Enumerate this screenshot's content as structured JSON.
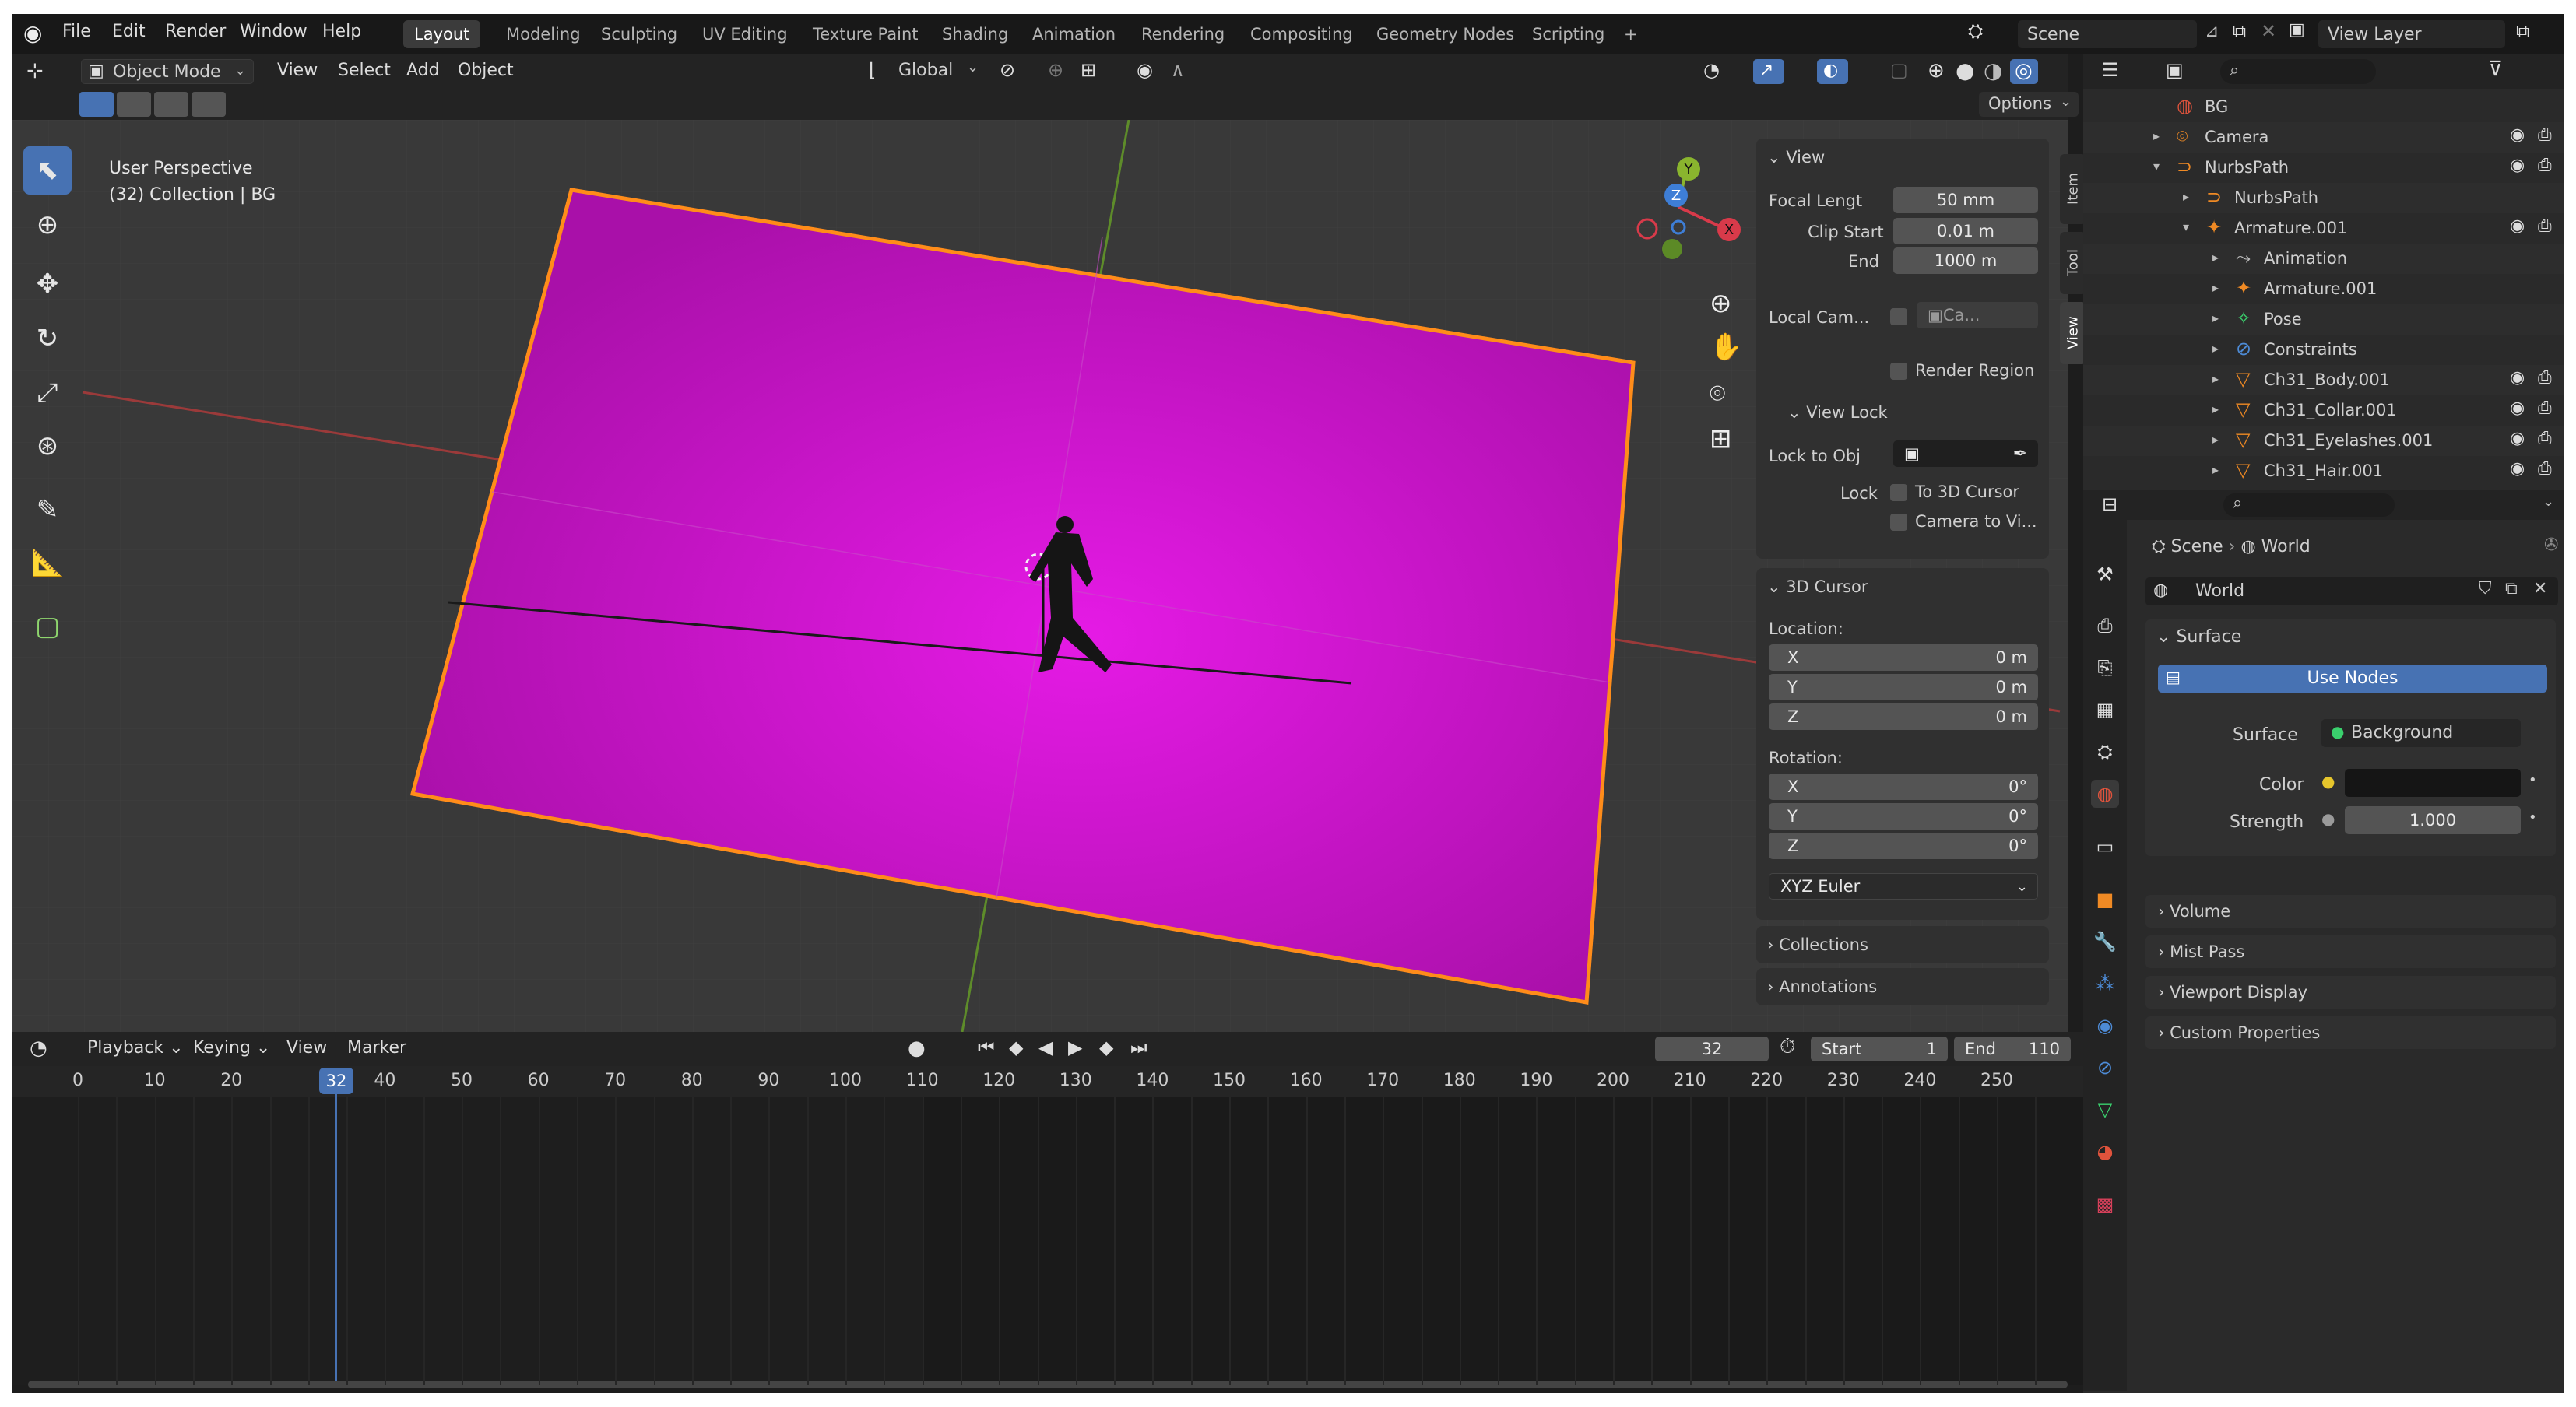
{
  "topbar": {
    "menus": [
      "File",
      "Edit",
      "Render",
      "Window",
      "Help"
    ],
    "workspaces": [
      "Layout",
      "Modeling",
      "Sculpting",
      "UV Editing",
      "Texture Paint",
      "Shading",
      "Animation",
      "Rendering",
      "Compositing",
      "Geometry Nodes",
      "Scripting"
    ],
    "active_workspace": "Layout",
    "add_tab": "+",
    "scene": "Scene",
    "view_layer": "View Layer"
  },
  "header": {
    "mode": "Object Mode",
    "menus": [
      "View",
      "Select",
      "Add",
      "Object"
    ],
    "orientation": "Global",
    "options": "Options"
  },
  "viewport": {
    "perspective": "User Perspective",
    "collection": "(32) Collection | BG",
    "gizmo": {
      "x": "X",
      "y": "Y",
      "z": "Z"
    },
    "plane_color": "#d616d6",
    "outline_color": "#ff8c1a"
  },
  "npanel": {
    "tabs": [
      "Item",
      "Tool",
      "View"
    ],
    "active_tab": "View",
    "view": {
      "title": "View",
      "focal_label": "Focal Lengt",
      "focal_value": "50 mm",
      "clip_start_label": "Clip Start",
      "clip_start_value": "0.01 m",
      "end_label": "End",
      "end_value": "1000 m",
      "local_cam_label": "Local Cam...",
      "local_cam_value": "Ca...",
      "render_region": "Render Region"
    },
    "view_lock": {
      "title": "View Lock",
      "lock_to_obj": "Lock to Obj",
      "lock": "Lock",
      "to_3d_cursor": "To 3D Cursor",
      "camera_to_view": "Camera to Vi..."
    },
    "cursor": {
      "title": "3D Cursor",
      "location": "Location:",
      "lx": "X",
      "lx_v": "0 m",
      "ly": "Y",
      "ly_v": "0 m",
      "lz": "Z",
      "lz_v": "0 m",
      "rotation": "Rotation:",
      "rx": "X",
      "rx_v": "0°",
      "ry": "Y",
      "ry_v": "0°",
      "rz": "Z",
      "rz_v": "0°",
      "mode": "XYZ Euler"
    },
    "collections": "Collections",
    "annotations": "Annotations"
  },
  "timeline": {
    "menus": [
      "Playback",
      "Keying",
      "View",
      "Marker"
    ],
    "current_frame": "32",
    "start_label": "Start",
    "start_value": "1",
    "end_label": "End",
    "end_value": "110",
    "ticks": [
      "0",
      "10",
      "20",
      "32",
      "40",
      "50",
      "60",
      "70",
      "80",
      "90",
      "100",
      "110",
      "120",
      "130",
      "140",
      "150",
      "160",
      "170",
      "180",
      "190",
      "200",
      "210",
      "220",
      "230",
      "240",
      "250"
    ]
  },
  "outliner": {
    "rows": [
      {
        "label": "BG",
        "indent": 0
      },
      {
        "label": "Camera",
        "indent": 0
      },
      {
        "label": "NurbsPath",
        "indent": 0
      },
      {
        "label": "NurbsPath",
        "indent": 1
      },
      {
        "label": "Armature.001",
        "indent": 1
      },
      {
        "label": "Animation",
        "indent": 2
      },
      {
        "label": "Armature.001",
        "indent": 2
      },
      {
        "label": "Pose",
        "indent": 2
      },
      {
        "label": "Constraints",
        "indent": 2
      },
      {
        "label": "Ch31_Body.001",
        "indent": 2
      },
      {
        "label": "Ch31_Collar.001",
        "indent": 2
      },
      {
        "label": "Ch31_Eyelashes.001",
        "indent": 2
      },
      {
        "label": "Ch31_Hair.001",
        "indent": 2
      }
    ]
  },
  "properties": {
    "breadcrumb_scene": "Scene",
    "breadcrumb_world": "World",
    "world_name": "World",
    "surface": "Surface",
    "use_nodes": "Use Nodes",
    "surface_label": "Surface",
    "surface_value": "Background",
    "color_label": "Color",
    "strength_label": "Strength",
    "strength_value": "1.000",
    "volume": "Volume",
    "mist_pass": "Mist Pass",
    "viewport_display": "Viewport Display",
    "custom_properties": "Custom Properties"
  }
}
